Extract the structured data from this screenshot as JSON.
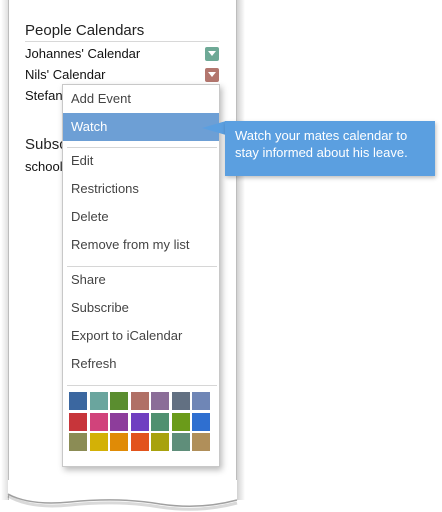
{
  "sidebar": {
    "people_title": "People Calendars",
    "calendars": [
      {
        "label": "Johannes' Calendar",
        "color": "#6ea996"
      },
      {
        "label": "Nils' Calendar",
        "color": "#b3766e"
      },
      {
        "label": "Stefan"
      }
    ],
    "subscribed_title": "Subsc",
    "subscribed_items": [
      {
        "label": "school"
      }
    ]
  },
  "menu": {
    "group1": [
      "Add Event",
      "Watch"
    ],
    "group2": [
      "Edit",
      "Restrictions",
      "Delete",
      "Remove from my list"
    ],
    "group3": [
      "Share",
      "Subscribe",
      "Export to iCalendar",
      "Refresh"
    ],
    "active_item": "Watch",
    "colors": [
      [
        "#3b67a0",
        "#6aa59e",
        "#5a8d2f",
        "#b07066",
        "#8b6d98",
        "#627082",
        "#6f86b6"
      ],
      [
        "#c7353a",
        "#d1437b",
        "#8d3d9b",
        "#6f3fc1",
        "#4f9070",
        "#6b9b1a",
        "#2f6fd0"
      ],
      [
        "#8b8c55",
        "#d3b106",
        "#e08b06",
        "#e2531c",
        "#a8a20e",
        "#5f8e7a",
        "#b08f5a"
      ]
    ]
  },
  "tooltip": {
    "text": "Watch your mates calendar to stay informed about his leave."
  }
}
